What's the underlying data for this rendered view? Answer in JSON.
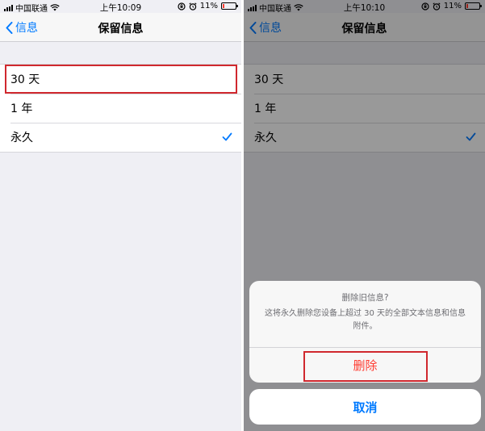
{
  "left": {
    "status": {
      "carrier": "中国联通",
      "time": "上午10:09",
      "battery": "11%"
    },
    "nav": {
      "back_label": "信息",
      "title": "保留信息"
    },
    "options": [
      {
        "label": "30 天",
        "selected": false
      },
      {
        "label": "1 年",
        "selected": false
      },
      {
        "label": "永久",
        "selected": true
      }
    ]
  },
  "right": {
    "status": {
      "carrier": "中国联通",
      "time": "上午10:10",
      "battery": "11%"
    },
    "nav": {
      "back_label": "信息",
      "title": "保留信息"
    },
    "options": [
      {
        "label": "30 天",
        "selected": false
      },
      {
        "label": "1 年",
        "selected": false
      },
      {
        "label": "永久",
        "selected": true
      }
    ],
    "action_sheet": {
      "title": "删除旧信息?",
      "message": "这将永久删除您设备上超过 30 天的全部文本信息和信息附件。",
      "delete_label": "删除",
      "cancel_label": "取消"
    }
  },
  "colors": {
    "accent": "#007aff",
    "destructive": "#ff3b30",
    "annotation_red": "#d0282e",
    "background": "#efeff4"
  },
  "icons": [
    "signal-icon",
    "wifi-icon",
    "lock-rotation-icon",
    "alarm-icon",
    "battery-icon",
    "chevron-left-icon",
    "checkmark-icon"
  ]
}
